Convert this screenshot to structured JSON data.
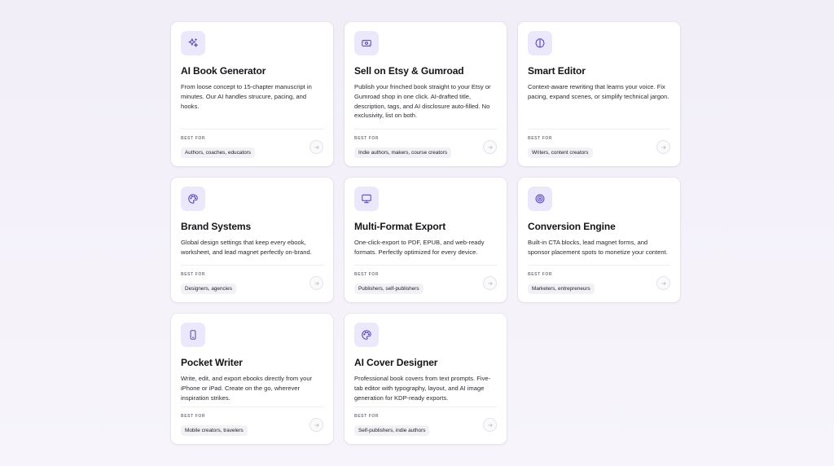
{
  "accent_color": "#5b46c9",
  "best_for_label": "BEST FOR",
  "cards": [
    {
      "icon": "sparkles-icon",
      "title": "AI Book Generator",
      "description": "From loose concept to 15-chapter manuscript in minutes. Our AI handles strucure, pacing, and hooks.",
      "best_for": "Authors, coaches, educators"
    },
    {
      "icon": "money-icon",
      "title": "Sell on Etsy & Gumroad",
      "description": "Publish your frinched book straight to your Etsy or Gumroad shop in one click. AI-drafted title, description, tags, and AI disclosure auto-filled. No exclusivity, list on both.",
      "best_for": "Indie authors, makers, course creators"
    },
    {
      "icon": "brain-icon",
      "title": "Smart Editor",
      "description": "Context-aware rewriting that learns your voice. Fix pacing, expand scenes, or simplify technical jargon.",
      "best_for": "Writers, content creators"
    },
    {
      "icon": "palette-icon",
      "title": "Brand Systems",
      "description": "Global design settings that keep every ebook, worksheet, and lead magnet perfectly on-brand.",
      "best_for": "Designers, agencies"
    },
    {
      "icon": "monitor-icon",
      "title": "Multi-Format Export",
      "description": "One-click-export to PDF, EPUB, and web-ready formats. Perfectly optimized for every device.",
      "best_for": "Publishers, self-publishers"
    },
    {
      "icon": "target-icon",
      "title": "Conversion Engine",
      "description": "Built-in CTA blocks, lead magnet forms, and sponsor placement spots to monetize your content.",
      "best_for": "Marketers, entrepreneurs"
    },
    {
      "icon": "phone-icon",
      "title": "Pocket Writer",
      "description": "Write, edit, and export ebooks directly from your iPhone or iPad. Create on the go, wherever inspiration strikes.",
      "best_for": "Mobile creators, travelers"
    },
    {
      "icon": "palette-icon",
      "title": "AI Cover Designer",
      "description": "Professional book covers from text prompts. Five-tab editor with typography, layout, and AI image generation for KDP-ready exports.",
      "best_for": "Self-publishers, indie authors"
    }
  ]
}
